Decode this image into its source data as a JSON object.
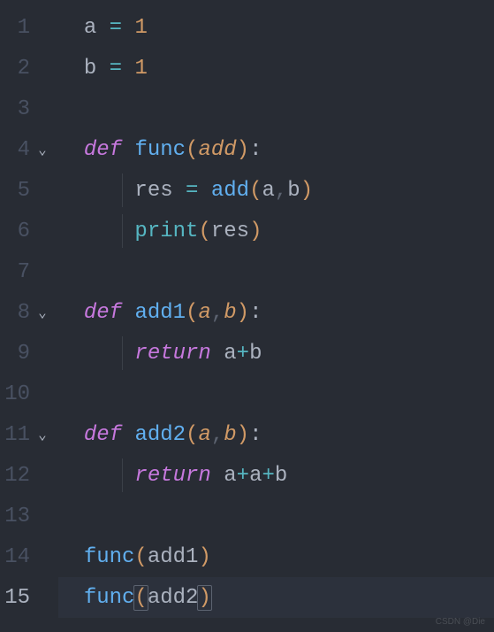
{
  "lines": [
    {
      "num": "1",
      "fold": "",
      "active": false,
      "highlighted": false,
      "guide": false,
      "tokens": [
        {
          "cls": "tok-white",
          "text": "a "
        },
        {
          "cls": "tok-op",
          "text": "="
        },
        {
          "cls": "tok-white",
          "text": " "
        },
        {
          "cls": "tok-num",
          "text": "1"
        }
      ]
    },
    {
      "num": "2",
      "fold": "",
      "active": false,
      "highlighted": false,
      "guide": false,
      "tokens": [
        {
          "cls": "tok-white",
          "text": "b "
        },
        {
          "cls": "tok-op",
          "text": "="
        },
        {
          "cls": "tok-white",
          "text": " "
        },
        {
          "cls": "tok-num",
          "text": "1"
        }
      ]
    },
    {
      "num": "3",
      "fold": "",
      "active": false,
      "highlighted": false,
      "guide": false,
      "tokens": []
    },
    {
      "num": "4",
      "fold": "⌄",
      "active": false,
      "highlighted": false,
      "guide": false,
      "tokens": [
        {
          "cls": "tok-kw",
          "text": "def"
        },
        {
          "cls": "tok-white",
          "text": " "
        },
        {
          "cls": "tok-func",
          "text": "func"
        },
        {
          "cls": "tok-paren1",
          "text": "("
        },
        {
          "cls": "tok-param",
          "text": "add"
        },
        {
          "cls": "tok-paren1",
          "text": ")"
        },
        {
          "cls": "tok-punct",
          "text": ":"
        }
      ]
    },
    {
      "num": "5",
      "fold": "",
      "active": false,
      "highlighted": false,
      "guide": true,
      "tokens": [
        {
          "cls": "tok-white",
          "text": "    res "
        },
        {
          "cls": "tok-op",
          "text": "="
        },
        {
          "cls": "tok-white",
          "text": " "
        },
        {
          "cls": "tok-func",
          "text": "add"
        },
        {
          "cls": "tok-paren1",
          "text": "("
        },
        {
          "cls": "tok-white",
          "text": "a"
        },
        {
          "cls": "tok-comma",
          "text": ","
        },
        {
          "cls": "tok-white",
          "text": "b"
        },
        {
          "cls": "tok-paren1",
          "text": ")"
        }
      ]
    },
    {
      "num": "6",
      "fold": "",
      "active": false,
      "highlighted": false,
      "guide": true,
      "tokens": [
        {
          "cls": "tok-white",
          "text": "    "
        },
        {
          "cls": "tok-builtin",
          "text": "print"
        },
        {
          "cls": "tok-paren1",
          "text": "("
        },
        {
          "cls": "tok-white",
          "text": "res"
        },
        {
          "cls": "tok-paren1",
          "text": ")"
        }
      ]
    },
    {
      "num": "7",
      "fold": "",
      "active": false,
      "highlighted": false,
      "guide": false,
      "tokens": []
    },
    {
      "num": "8",
      "fold": "⌄",
      "active": false,
      "highlighted": false,
      "guide": false,
      "tokens": [
        {
          "cls": "tok-kw",
          "text": "def"
        },
        {
          "cls": "tok-white",
          "text": " "
        },
        {
          "cls": "tok-func",
          "text": "add1"
        },
        {
          "cls": "tok-paren1",
          "text": "("
        },
        {
          "cls": "tok-param",
          "text": "a"
        },
        {
          "cls": "tok-comma",
          "text": ","
        },
        {
          "cls": "tok-param",
          "text": "b"
        },
        {
          "cls": "tok-paren1",
          "text": ")"
        },
        {
          "cls": "tok-punct",
          "text": ":"
        }
      ]
    },
    {
      "num": "9",
      "fold": "",
      "active": false,
      "highlighted": false,
      "guide": true,
      "tokens": [
        {
          "cls": "tok-white",
          "text": "    "
        },
        {
          "cls": "tok-kw",
          "text": "return"
        },
        {
          "cls": "tok-white",
          "text": " a"
        },
        {
          "cls": "tok-op",
          "text": "+"
        },
        {
          "cls": "tok-white",
          "text": "b"
        }
      ]
    },
    {
      "num": "10",
      "fold": "",
      "active": false,
      "highlighted": false,
      "guide": false,
      "tokens": []
    },
    {
      "num": "11",
      "fold": "⌄",
      "active": false,
      "highlighted": false,
      "guide": false,
      "tokens": [
        {
          "cls": "tok-kw",
          "text": "def"
        },
        {
          "cls": "tok-white",
          "text": " "
        },
        {
          "cls": "tok-func",
          "text": "add2"
        },
        {
          "cls": "tok-paren1",
          "text": "("
        },
        {
          "cls": "tok-param",
          "text": "a"
        },
        {
          "cls": "tok-comma",
          "text": ","
        },
        {
          "cls": "tok-param",
          "text": "b"
        },
        {
          "cls": "tok-paren1",
          "text": ")"
        },
        {
          "cls": "tok-punct",
          "text": ":"
        }
      ]
    },
    {
      "num": "12",
      "fold": "",
      "active": false,
      "highlighted": false,
      "guide": true,
      "tokens": [
        {
          "cls": "tok-white",
          "text": "    "
        },
        {
          "cls": "tok-kw",
          "text": "return"
        },
        {
          "cls": "tok-white",
          "text": " a"
        },
        {
          "cls": "tok-op",
          "text": "+"
        },
        {
          "cls": "tok-white",
          "text": "a"
        },
        {
          "cls": "tok-op",
          "text": "+"
        },
        {
          "cls": "tok-white",
          "text": "b"
        }
      ]
    },
    {
      "num": "13",
      "fold": "",
      "active": false,
      "highlighted": false,
      "guide": false,
      "tokens": []
    },
    {
      "num": "14",
      "fold": "",
      "active": false,
      "highlighted": false,
      "guide": false,
      "tokens": [
        {
          "cls": "tok-func",
          "text": "func"
        },
        {
          "cls": "tok-paren1",
          "text": "("
        },
        {
          "cls": "tok-white",
          "text": "add1"
        },
        {
          "cls": "tok-paren1",
          "text": ")"
        }
      ]
    },
    {
      "num": "15",
      "fold": "",
      "active": true,
      "highlighted": true,
      "guide": false,
      "tokens": [
        {
          "cls": "tok-func",
          "text": "func"
        },
        {
          "cls": "tok-paren1",
          "text": "(",
          "bracket": true
        },
        {
          "cls": "tok-white",
          "text": "add2"
        },
        {
          "cls": "tok-paren1",
          "text": ")",
          "bracket": true
        }
      ]
    }
  ],
  "watermark": "CSDN @Die"
}
